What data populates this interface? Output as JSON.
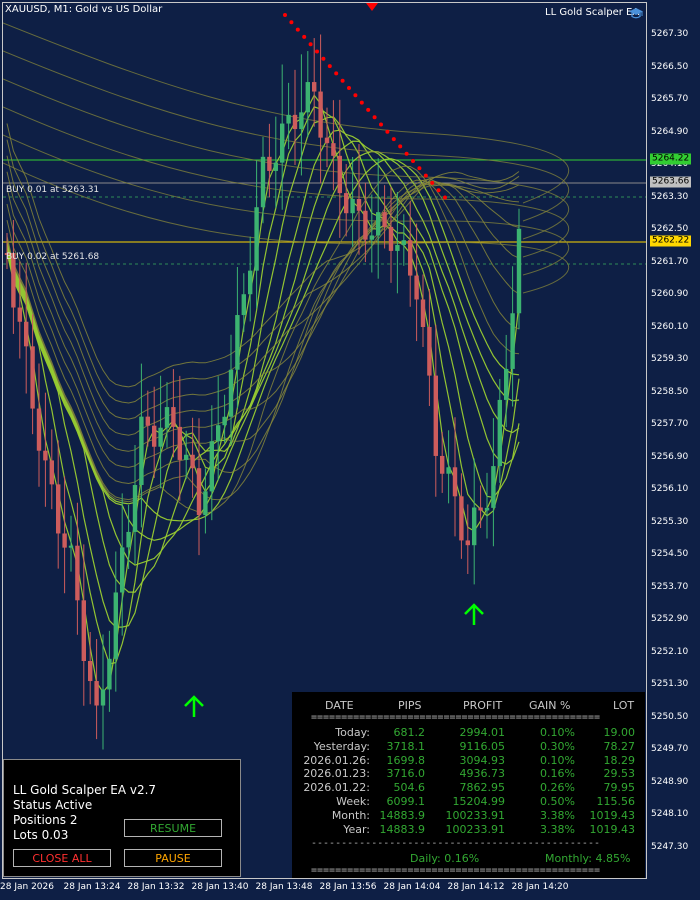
{
  "window": {
    "symbol_label": "XAUUSD, M1:  Gold vs US Dollar",
    "ea_name": "LL Gold Scalper EA",
    "ea_icon": "graduation-cap-icon"
  },
  "price_axis": {
    "ticks": [
      "5267.30",
      "5266.50",
      "5265.70",
      "5264.90",
      "5264.10",
      "5263.30",
      "5262.50",
      "5261.70",
      "5260.90",
      "5260.10",
      "5259.30",
      "5258.50",
      "5257.70",
      "5256.90",
      "5256.10",
      "5255.30",
      "5254.50",
      "5253.70",
      "5252.90",
      "5252.10",
      "5251.30",
      "5250.50",
      "5249.70",
      "5248.90",
      "5248.10",
      "5247.30"
    ]
  },
  "time_axis": {
    "ticks": [
      "28 Jan 2026",
      "28 Jan 13:24",
      "28 Jan 13:32",
      "28 Jan 13:40",
      "28 Jan 13:48",
      "28 Jan 13:56",
      "28 Jan 14:04",
      "28 Jan 14:12",
      "28 Jan 14:20"
    ]
  },
  "levels": {
    "tp_price": "5264.22",
    "current_price": "5263.66",
    "bid_price": "5262.22"
  },
  "orders": [
    {
      "label": "BUY 0.01 at 5263.31",
      "price": 5263.31
    },
    {
      "label": "BUY 0.02 at 5261.68",
      "price": 5261.68
    }
  ],
  "colors": {
    "background": "#0e1f45",
    "bull_candle": "#3cb371",
    "bear_candle": "#cd5c5c",
    "tp_line": "#32cd32",
    "bid_line": "#ffd700",
    "order_line": "#2e8b57",
    "sar_dots": "#ff0000",
    "buy_arrow": "#00ff00",
    "ribbon_light": "#9acd32",
    "ribbon_dark": "#8b8b3a"
  },
  "ea_panel": {
    "title": "LL Gold Scalper EA",
    "version": "v2.7",
    "status_label": "Status",
    "status_value": "Active",
    "positions_label": "Positions",
    "positions_value": "2",
    "lots_label": "Lots",
    "lots_value": "0.03",
    "resume_label": "RESUME",
    "close_all_label": "CLOSE ALL",
    "pause_label": "PAUSE"
  },
  "stats": {
    "headers": [
      "DATE",
      "PIPS",
      "PROFIT",
      "GAIN %",
      "LOT"
    ],
    "separator": "================================================",
    "rows": [
      {
        "date": "Today:",
        "pips": "681.2",
        "profit": "2994.01",
        "gain": "0.10%",
        "lot": "19.00"
      },
      {
        "date": "Yesterday:",
        "pips": "3718.1",
        "profit": "9116.05",
        "gain": "0.30%",
        "lot": "78.27"
      },
      {
        "date": "2026.01.26:",
        "pips": "1699.8",
        "profit": "3094.93",
        "gain": "0.10%",
        "lot": "18.29"
      },
      {
        "date": "2026.01.23:",
        "pips": "3716.0",
        "profit": "4936.73",
        "gain": "0.16%",
        "lot": "29.53"
      },
      {
        "date": "2026.01.22:",
        "pips": "504.6",
        "profit": "7862.95",
        "gain": "0.26%",
        "lot": "79.95"
      },
      {
        "date": "Week:",
        "pips": "6099.1",
        "profit": "15204.99",
        "gain": "0.50%",
        "lot": "115.56"
      },
      {
        "date": "Month:",
        "pips": "14883.9",
        "profit": "100233.91",
        "gain": "3.38%",
        "lot": "1019.43"
      },
      {
        "date": "Year:",
        "pips": "14883.9",
        "profit": "100233.91",
        "gain": "3.38%",
        "lot": "1019.43"
      }
    ],
    "dash_separator": "------------------------------------------------",
    "daily": "Daily: 0.16%",
    "monthly": "Monthly: 4.85%"
  }
}
